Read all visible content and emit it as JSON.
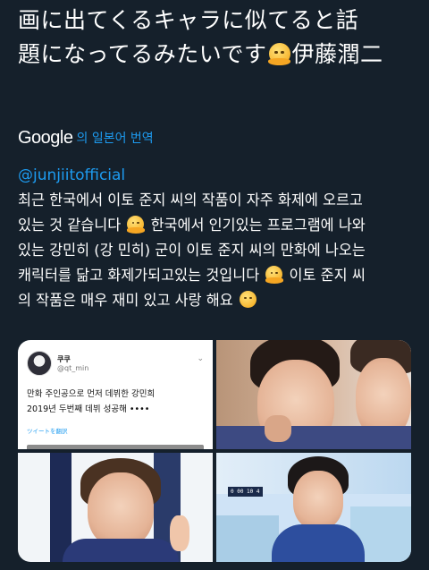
{
  "tweet": {
    "lines": [
      "画に出てくるキャラに似てると話",
      "題になってるみたいです",
      "伊藤潤二"
    ]
  },
  "translate": {
    "logo": "Google",
    "meta": "의 일본어 번역"
  },
  "translation": {
    "handle": "@junjiitofficial",
    "l1": "최근 한국에서 이토 준지 씨의 작품이 자주 화제에 오르고",
    "l2a": "있는 것 같습니다",
    "l2b": "한국에서 인기있는 프로그램에 나와",
    "l3": "있는 강민히 (강 민히) 군이 이토 준지 씨의 만화에 나오는",
    "l4a": "캐릭터를 닮고 화제가되고있는 것입니다",
    "l4b": "이토 준지 씨",
    "l5a": "의 작품은 매우 재미 있고 사랑 해요"
  },
  "media": {
    "mini_tweet": {
      "name": "쿠쿠",
      "handle": "@qt_min",
      "chevron": "⌄",
      "line1": "만화 주인공으로 먼저 데뷔한 강민희",
      "line2": "2019년 두번째 데뷔 성공해 ••••",
      "translate": "ツイートを翻訳"
    },
    "badge_text": "0 00 10 4"
  }
}
